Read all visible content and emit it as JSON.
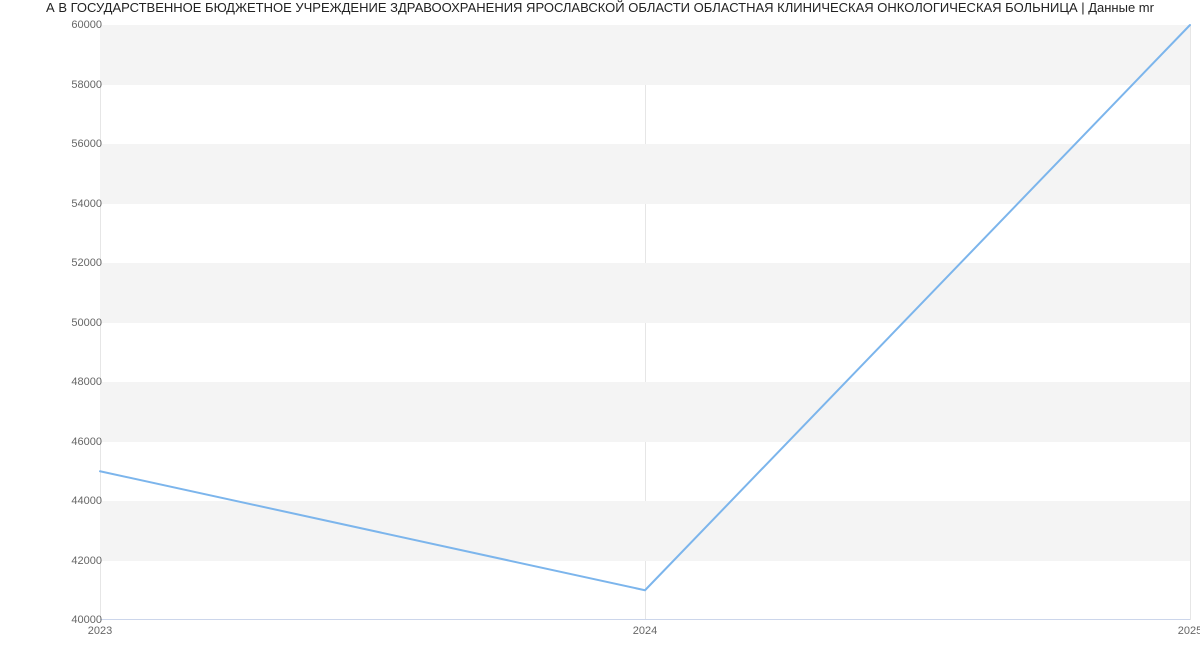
{
  "chart_data": {
    "type": "line",
    "title": "А В ГОСУДАРСТВЕННОЕ БЮДЖЕТНОЕ УЧРЕЖДЕНИЕ ЗДРАВООХРАНЕНИЯ ЯРОСЛАВСКОЙ ОБЛАСТИ ОБЛАСТНАЯ КЛИНИЧЕСКАЯ ОНКОЛОГИЧЕСКАЯ БОЛЬНИЦА | Данные mr",
    "categories": [
      "2023",
      "2024",
      "2025"
    ],
    "values": [
      45000,
      41000,
      60000
    ],
    "xlabel": "",
    "ylabel": "",
    "ylim": [
      40000,
      60000
    ],
    "yticks": [
      40000,
      42000,
      44000,
      46000,
      48000,
      50000,
      52000,
      54000,
      56000,
      58000,
      60000
    ],
    "series_color": "#7cb5ec"
  }
}
